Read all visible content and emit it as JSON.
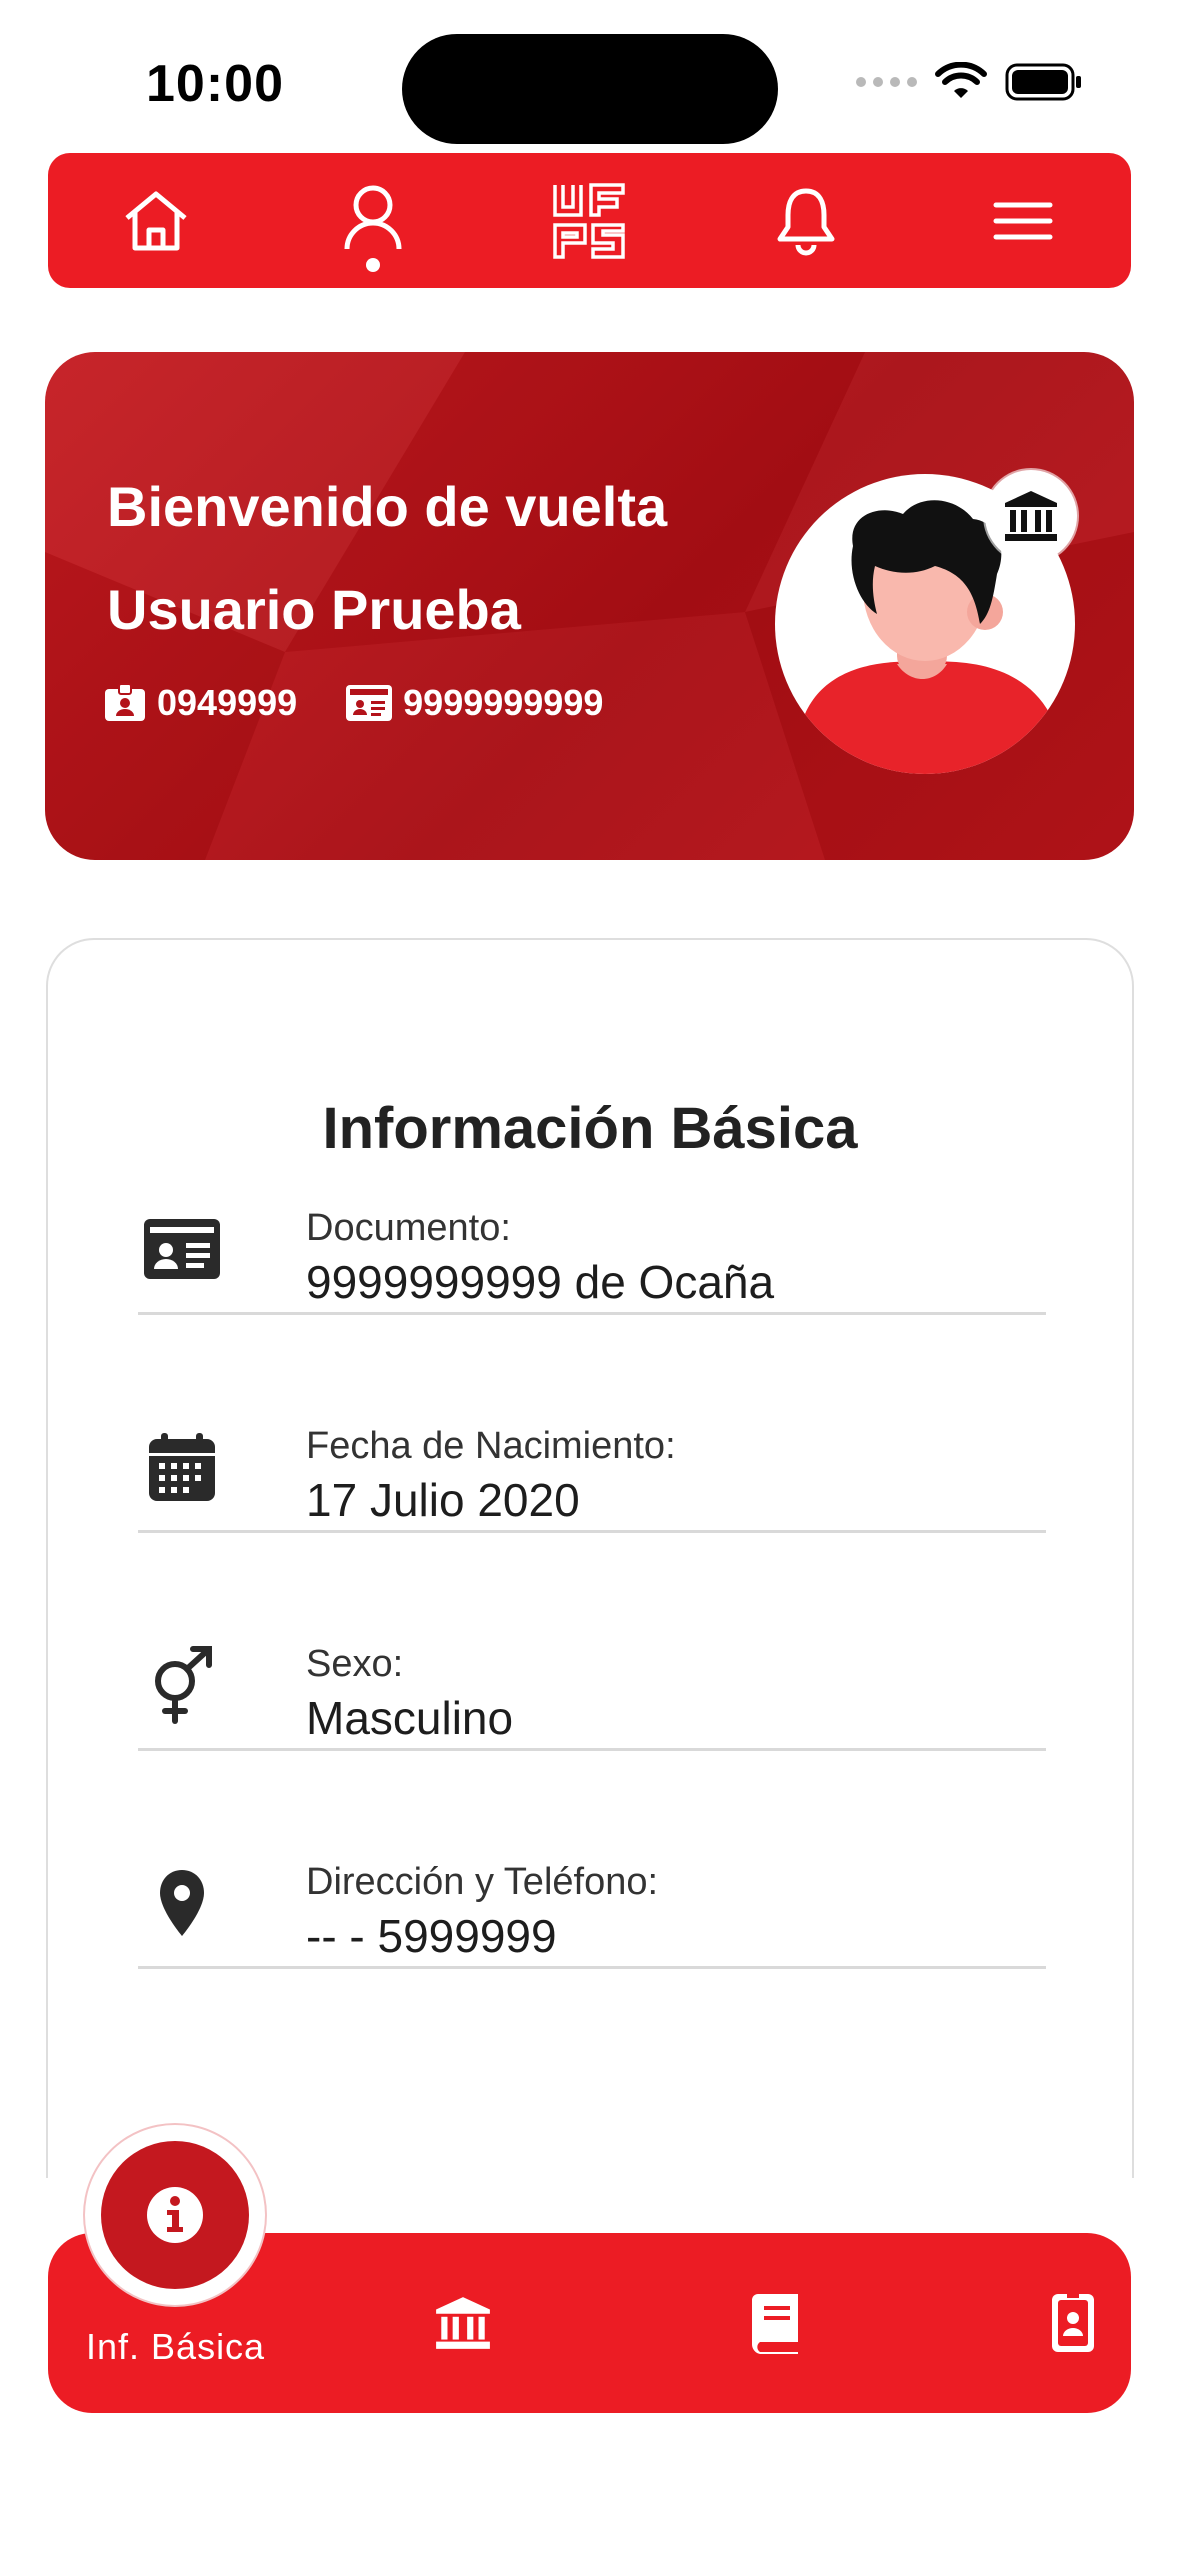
{
  "status_bar": {
    "time": "10:00"
  },
  "top_nav": {
    "items": [
      {
        "icon": "home-icon"
      },
      {
        "icon": "user-icon",
        "active": true
      },
      {
        "icon": "ufps-logo"
      },
      {
        "icon": "bell-icon"
      },
      {
        "icon": "menu-icon"
      }
    ]
  },
  "hero": {
    "greeting": "Bienvenido de vuelta",
    "name": "Usuario Prueba",
    "student_code": "0949999",
    "document_number": "9999999999"
  },
  "info": {
    "title": "Información Básica",
    "rows": [
      {
        "icon": "id-card-icon",
        "label": "Documento:",
        "value": "9999999999 de Ocaña"
      },
      {
        "icon": "calendar-icon",
        "label": "Fecha de Nacimiento:",
        "value": "17 Julio 2020"
      },
      {
        "icon": "gender-icon",
        "label": "Sexo:",
        "value": "Masculino"
      },
      {
        "icon": "location-pin-icon",
        "label": "Dirección y Teléfono:",
        "value": "-- - 5999999"
      }
    ]
  },
  "bottom_nav": {
    "active_label": "Inf. Básica",
    "items": [
      {
        "icon": "info-icon",
        "active": true
      },
      {
        "icon": "institution-icon"
      },
      {
        "icon": "book-icon"
      },
      {
        "icon": "badge-icon"
      }
    ]
  },
  "colors": {
    "primary": "#ec1c24",
    "hero_dark": "#a90e14",
    "active_bubble": "#c4181f"
  }
}
